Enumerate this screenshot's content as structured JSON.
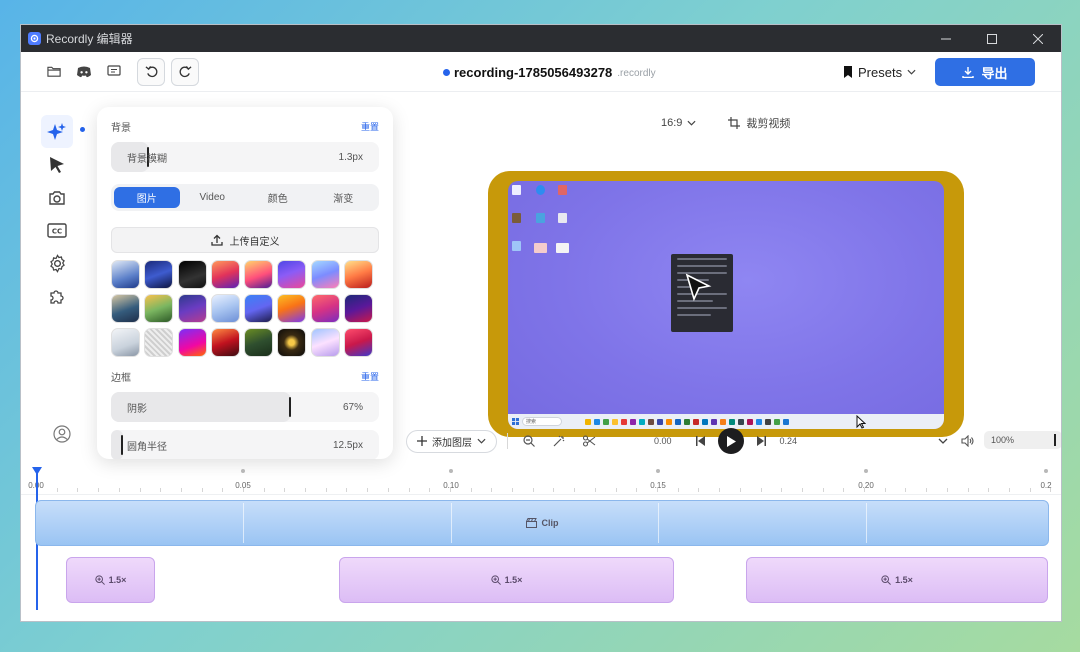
{
  "window": {
    "title": "Recordly 编辑器"
  },
  "toolbar": {
    "filename": "recording-1785056493278",
    "extension": ".recordly",
    "presets_label": "Presets",
    "export_label": "导出"
  },
  "panel": {
    "background": {
      "title": "背景",
      "reset": "重置"
    },
    "blur": {
      "label": "背景模糊",
      "value": "1.3px"
    },
    "tabs": [
      {
        "label": "图片",
        "active": true
      },
      {
        "label": "Video",
        "active": false
      },
      {
        "label": "颜色",
        "active": false
      },
      {
        "label": "渐变",
        "active": false
      }
    ],
    "upload_label": "上传自定义",
    "frame": {
      "title": "边框",
      "reset": "重置"
    },
    "shadow": {
      "label": "阴影",
      "value": "67%",
      "fill": 0.67
    },
    "radius": {
      "label": "圆角半径",
      "value": "12.5px"
    }
  },
  "preview": {
    "aspect": "16:9",
    "crop_label": "裁剪视频",
    "taskbar_search": "搜索"
  },
  "playback": {
    "add_layer": "添加图层",
    "current_time": "0.00",
    "end_time": "0.24",
    "zoom": "100%"
  },
  "timeline": {
    "ticks": [
      "0.00",
      "0.05",
      "0.10",
      "0.15",
      "0.20",
      "0.2"
    ],
    "clip_label": "Clip",
    "zoom_segments": [
      {
        "label": "1.5×"
      },
      {
        "label": "1.5×"
      },
      {
        "label": "1.5×"
      }
    ]
  },
  "colors": {
    "accent": "#2f6fe4",
    "frame": "#c7990a",
    "clip": "#9ac4f3",
    "zoom_segment": "#dcbdf5"
  },
  "wallpapers": [
    "linear-gradient(160deg,#dfe8f5,#5b7fc9 60%,#1e3a8a)",
    "linear-gradient(160deg,#1b2a7a,#3e5ccf 50%,#0e1440)",
    "linear-gradient(160deg,#000,#333 60%,#111)",
    "linear-gradient(160deg,#ff9a5c,#e2335a 50%,#5b21b6)",
    "linear-gradient(160deg,#ffd36b,#ff4f7b 55%,#4c1d95)",
    "linear-gradient(160deg,#4f46e5,#8b5cf6 45%,#ec4899)",
    "linear-gradient(160deg,#a5d8ff,#7c8cff 50%,#ff7eb6)",
    "linear-gradient(160deg,#ffe08a,#ff7a45 50%,#b91c1c)",
    "linear-gradient(160deg,#d7c7a3,#355c7d 55%,#1f2f4a)",
    "linear-gradient(160deg,#f8c14d,#7bb661 50%,#2d5a27)",
    "linear-gradient(160deg,#2e3a8c,#6a3cc2 50%,#b63c8f)",
    "linear-gradient(160deg,#e8f0ff,#a8c4f0 50%,#6d8fd6)",
    "linear-gradient(160deg,#3b82f6,#6366f1 50%,#1e1b4b)",
    "linear-gradient(160deg,#fbbf24,#f97316 45%,#7c3aed)",
    "linear-gradient(160deg,#ff6b6b,#d63384 50%,#7b2cbf)",
    "linear-gradient(160deg,#1e2a78,#5a189a 50%,#c9184a)",
    "linear-gradient(160deg,#f2f4f7,#c9d2dc 60%,#8a96a6)",
    "repeating-linear-gradient(45deg,#eee 0 2px,#cfcfcf 2px 4px)",
    "linear-gradient(160deg,#7b2ff7,#f107a3 60%,#ff6a00)",
    "linear-gradient(160deg,#ff8c42,#c1121f 50%,#3d0c11)",
    "linear-gradient(160deg,#6b8e23,#2f4f2f 50%,#1a2e1a)",
    "radial-gradient(circle,#f7c948 0 15%,#3a2a12 40%,#0b0b0b)",
    "linear-gradient(160deg,#a0c4ff,#fce1ff 50%,#b79ced)",
    "linear-gradient(160deg,#ff4d6d,#c9184a 50%,#3f37c9)"
  ]
}
